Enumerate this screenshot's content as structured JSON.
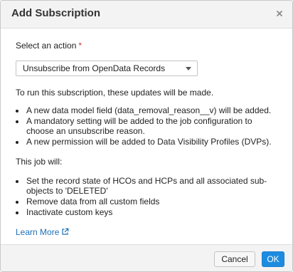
{
  "dialog": {
    "title": "Add Subscription",
    "close_icon": "close-icon"
  },
  "form": {
    "action_label": "Select an action",
    "required_marker": "*",
    "action_selected": "Unsubscribe from OpenData Records",
    "intro": "To run this subscription, these updates will be made.",
    "updates": [
      "A new data model field (data_removal_reason__v) will be added.",
      "A mandatory setting will be added to the job configuration to choose an unsubscribe reason.",
      "A new permission will be added to Data Visibility Profiles (DVPs)."
    ],
    "job_heading": "This job will:",
    "job_items": [
      "Set the record state of HCOs and HCPs and all associated sub-objects to 'DELETED'",
      "Remove data from all custom fields",
      "Inactivate custom keys"
    ],
    "learn_more": "Learn More",
    "learn_more_icon": "external-link-icon"
  },
  "footer": {
    "cancel_label": "Cancel",
    "ok_label": "OK"
  },
  "colors": {
    "primary_button": "#1d8ce0",
    "link": "#1f6fb5",
    "required": "#c23934",
    "header_bg": "#f3f3f3"
  }
}
